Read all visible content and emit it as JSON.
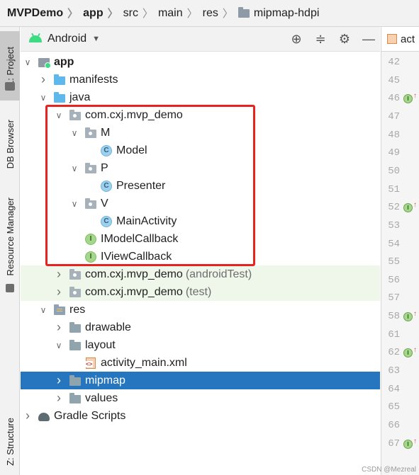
{
  "breadcrumbs": [
    {
      "label": "MVPDemo",
      "bold": true,
      "icon": ""
    },
    {
      "label": "app",
      "bold": true,
      "icon": ""
    },
    {
      "label": "src",
      "bold": false,
      "icon": ""
    },
    {
      "label": "main",
      "bold": false,
      "icon": ""
    },
    {
      "label": "res",
      "bold": false,
      "icon": ""
    },
    {
      "label": "mipmap-hdpi",
      "bold": false,
      "icon": "folder-icon"
    }
  ],
  "sidebar": {
    "tabs": [
      {
        "label": "1: Project",
        "active": true
      },
      {
        "label": "DB Browser",
        "active": false
      },
      {
        "label": "Resource Manager",
        "active": false
      },
      {
        "label": "Z: Structure",
        "active": false
      }
    ]
  },
  "panel": {
    "view_mode": "Android",
    "tools": [
      "locate-icon",
      "collapse-all-icon",
      "settings-icon",
      "minimize-icon"
    ]
  },
  "tree": [
    {
      "label": "app",
      "suffix": "",
      "depth": 0,
      "arrow": "down",
      "icon": "app-module-icon",
      "bold": true
    },
    {
      "label": "manifests",
      "suffix": "",
      "depth": 1,
      "arrow": "right",
      "icon": "folder-blue-icon"
    },
    {
      "label": "java",
      "suffix": "",
      "depth": 1,
      "arrow": "down",
      "icon": "folder-blue-icon"
    },
    {
      "label": "com.cxj.mvp_demo",
      "suffix": "",
      "depth": 2,
      "arrow": "down",
      "icon": "package-icon"
    },
    {
      "label": "M",
      "suffix": "",
      "depth": 3,
      "arrow": "down",
      "icon": "package-icon"
    },
    {
      "label": "Model",
      "suffix": "",
      "depth": 4,
      "arrow": "",
      "icon": "class-icon"
    },
    {
      "label": "P",
      "suffix": "",
      "depth": 3,
      "arrow": "down",
      "icon": "package-icon"
    },
    {
      "label": "Presenter",
      "suffix": "",
      "depth": 4,
      "arrow": "",
      "icon": "class-icon"
    },
    {
      "label": "V",
      "suffix": "",
      "depth": 3,
      "arrow": "down",
      "icon": "package-icon"
    },
    {
      "label": "MainActivity",
      "suffix": "",
      "depth": 4,
      "arrow": "",
      "icon": "class-icon"
    },
    {
      "label": "IModelCallback",
      "suffix": "",
      "depth": 3,
      "arrow": "",
      "icon": "interface-icon"
    },
    {
      "label": "IViewCallback",
      "suffix": "",
      "depth": 3,
      "arrow": "",
      "icon": "interface-icon"
    },
    {
      "label": "com.cxj.mvp_demo",
      "suffix": "(androidTest)",
      "depth": 2,
      "arrow": "right",
      "icon": "package-icon",
      "green": true
    },
    {
      "label": "com.cxj.mvp_demo",
      "suffix": "(test)",
      "depth": 2,
      "arrow": "right",
      "icon": "package-icon",
      "green": true
    },
    {
      "label": "res",
      "suffix": "",
      "depth": 1,
      "arrow": "down",
      "icon": "res-folder-icon"
    },
    {
      "label": "drawable",
      "suffix": "",
      "depth": 2,
      "arrow": "right",
      "icon": "folder-icon"
    },
    {
      "label": "layout",
      "suffix": "",
      "depth": 2,
      "arrow": "down",
      "icon": "folder-icon"
    },
    {
      "label": "activity_main.xml",
      "suffix": "",
      "depth": 3,
      "arrow": "",
      "icon": "xml-layout-icon"
    },
    {
      "label": "mipmap",
      "suffix": "",
      "depth": 2,
      "arrow": "right",
      "icon": "folder-icon",
      "selected": true
    },
    {
      "label": "values",
      "suffix": "",
      "depth": 2,
      "arrow": "right",
      "icon": "folder-icon"
    },
    {
      "label": "Gradle Scripts",
      "suffix": "",
      "depth": 0,
      "arrow": "right",
      "icon": "gradle-icon"
    }
  ],
  "editor": {
    "tab_label": "act",
    "line_numbers": [
      "42",
      "45",
      "46",
      "47",
      "48",
      "49",
      "50",
      "51",
      "52",
      "53",
      "54",
      "55",
      "56",
      "57",
      "58",
      "61",
      "62",
      "63",
      "64",
      "65",
      "66",
      "67"
    ],
    "implemented_markers": [
      "46",
      "52",
      "58",
      "62",
      "67"
    ]
  },
  "colors": {
    "selection": "#2675bf",
    "annotation_box": "#e8231f",
    "test_source_bg": "#eff7ea"
  },
  "watermark": "CSDN @Mezreal"
}
